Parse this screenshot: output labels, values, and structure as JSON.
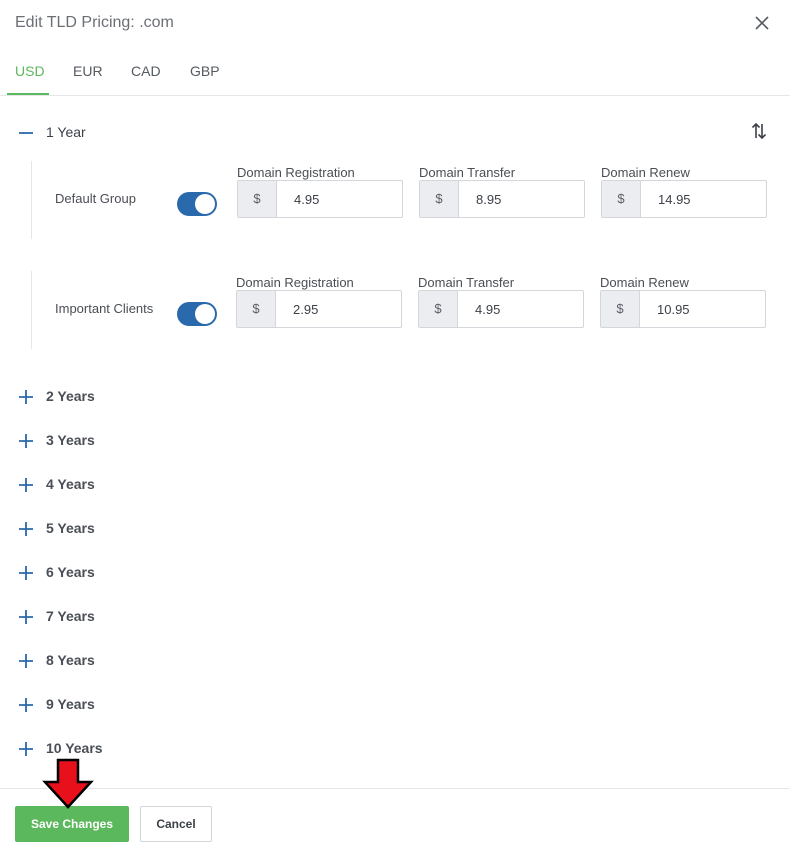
{
  "modal": {
    "title": "Edit TLD Pricing: .com"
  },
  "tabs": [
    {
      "label": "USD",
      "active": true
    },
    {
      "label": "EUR",
      "active": false
    },
    {
      "label": "CAD",
      "active": false
    },
    {
      "label": "GBP",
      "active": false
    }
  ],
  "expanded_period": {
    "label": "1 Year",
    "groups": [
      {
        "name": "Default Group",
        "enabled": true,
        "fields": [
          {
            "label": "Domain Registration",
            "prefix": "$",
            "value": "4.95"
          },
          {
            "label": "Domain Transfer",
            "prefix": "$",
            "value": "8.95"
          },
          {
            "label": "Domain Renew",
            "prefix": "$",
            "value": "14.95"
          }
        ]
      },
      {
        "name": "Important Clients",
        "enabled": true,
        "fields": [
          {
            "label": "Domain Registration",
            "prefix": "$",
            "value": "2.95"
          },
          {
            "label": "Domain Transfer",
            "prefix": "$",
            "value": "4.95"
          },
          {
            "label": "Domain Renew",
            "prefix": "$",
            "value": "10.95"
          }
        ]
      }
    ]
  },
  "collapsed_periods": [
    "2 Years",
    "3 Years",
    "4 Years",
    "5 Years",
    "6 Years",
    "7 Years",
    "8 Years",
    "9 Years",
    "10 Years"
  ],
  "footer": {
    "save_label": "Save Changes",
    "cancel_label": "Cancel"
  },
  "colors": {
    "accent_green": "#5cb85c",
    "switch_blue": "#2a6aac",
    "icon_blue": "#2a6aac",
    "annotation_arrow": "#e8101a"
  },
  "icons": {
    "close": "close-icon",
    "sort": "sort-arrows-icon",
    "collapse": "minus-icon",
    "expand": "plus-icon",
    "annotation": "arrow-down-icon"
  }
}
